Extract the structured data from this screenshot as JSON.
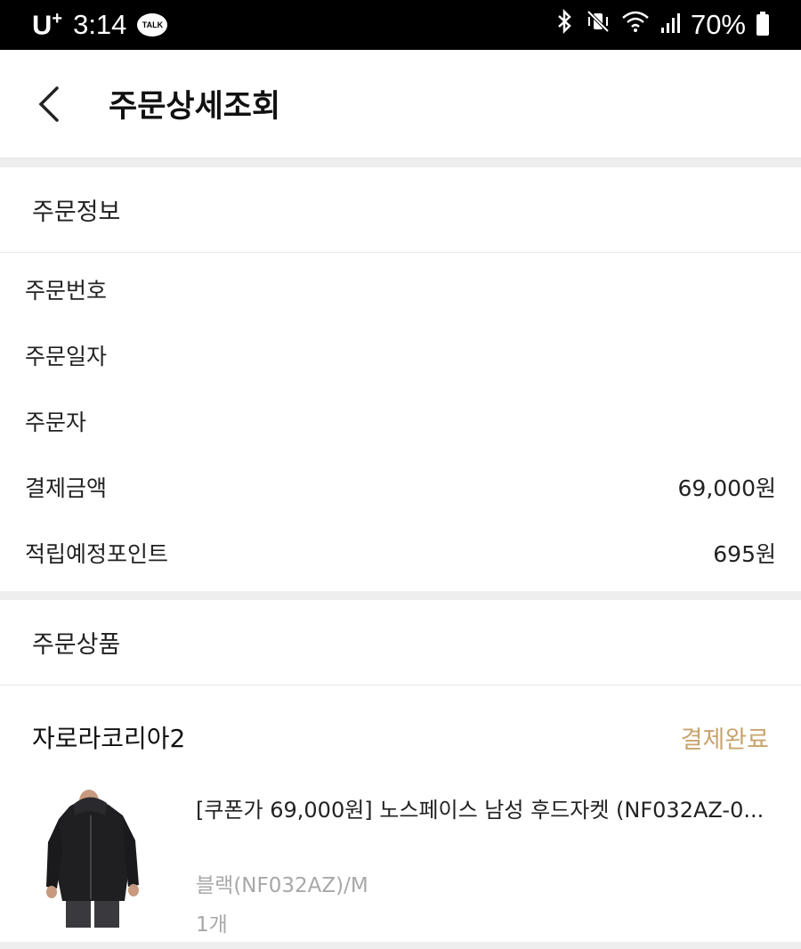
{
  "status_bar": {
    "carrier": "U",
    "carrier_sup": "+",
    "time": "3:14",
    "talk_badge": "TALK",
    "battery": "70%"
  },
  "header": {
    "title": "주문상세조회"
  },
  "order_info": {
    "section_title": "주문정보",
    "rows": [
      {
        "label": "주문번호",
        "value": ""
      },
      {
        "label": "주문일자",
        "value": ""
      },
      {
        "label": "주문자",
        "value": ""
      },
      {
        "label": "결제금액",
        "value": "69,000원"
      },
      {
        "label": "적립예정포인트",
        "value": "695원"
      }
    ]
  },
  "order_items": {
    "section_title": "주문상품",
    "seller": "자로라코리아2",
    "status": "결제완료",
    "status_color": "#c8a46e",
    "product": {
      "name": "[쿠폰가 69,000원] 노스페이스 남성 후드자켓 (NF032AZ-0...",
      "option": "블랙(NF032AZ)/M",
      "quantity": "1개"
    }
  }
}
